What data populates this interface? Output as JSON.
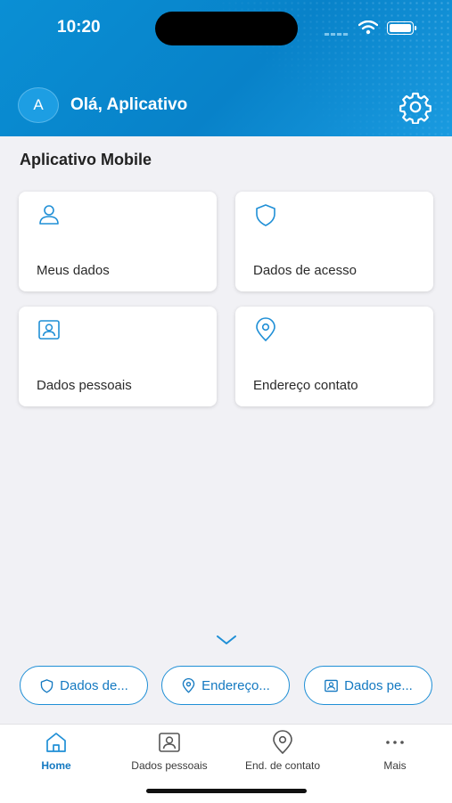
{
  "status_bar": {
    "time": "10:20"
  },
  "header": {
    "avatar_letter": "A",
    "greeting": "Olá, Aplicativo",
    "settings_icon": "gear-icon"
  },
  "section": {
    "title": "Aplicativo Mobile"
  },
  "cards": [
    {
      "label": "Meus dados",
      "icon": "person-icon"
    },
    {
      "label": "Dados de acesso",
      "icon": "shield-icon"
    },
    {
      "label": "Dados pessoais",
      "icon": "id-card-icon"
    },
    {
      "label": "Endereço contato",
      "icon": "location-pin-icon"
    }
  ],
  "shortcuts": [
    {
      "label": "Dados de...",
      "icon": "shield-icon"
    },
    {
      "label": "Endereço...",
      "icon": "location-pin-icon"
    },
    {
      "label": "Dados pe...",
      "icon": "id-card-icon"
    }
  ],
  "tabbar": {
    "active": "Home",
    "items": [
      {
        "label": "Home",
        "icon": "home-icon"
      },
      {
        "label": "Dados pessoais",
        "icon": "id-card-icon"
      },
      {
        "label": "End. de contato",
        "icon": "location-pin-icon"
      },
      {
        "label": "Mais",
        "icon": "more-dots-icon"
      }
    ]
  },
  "colors": {
    "accent": "#0a8fd4",
    "link": "#1479c1",
    "background": "#f1f1f5"
  }
}
